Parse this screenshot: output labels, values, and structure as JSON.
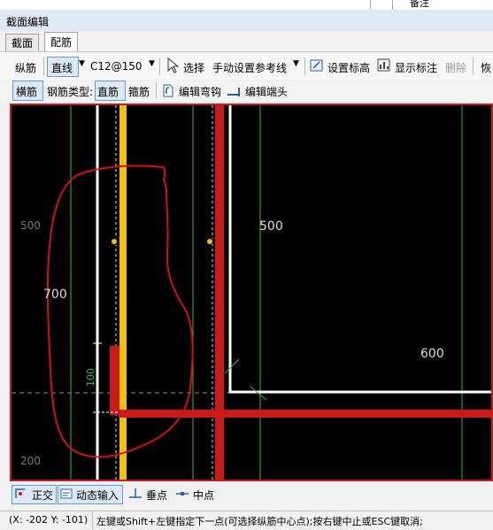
{
  "top_strip": {
    "text": "备注"
  },
  "window": {
    "title": "截面编辑"
  },
  "tabs": [
    {
      "label": "截面"
    },
    {
      "label": "配筋"
    }
  ],
  "toolbar1": {
    "longitudinal": "纵筋",
    "line_mode": "直线",
    "rebar_spec": "C12@150",
    "select": "选择",
    "manual_ref": "手动设置参考线",
    "set_elevation": "设置标高",
    "show_annotation": "显示标注",
    "delete": "删除",
    "restore": "恢"
  },
  "toolbar2": {
    "transverse": "横筋",
    "rebar_type_label": "钢筋类型:",
    "straight": "直筋",
    "stirrup": "箍筋",
    "edit_hook": "编辑弯钩",
    "edit_end": "编辑端头"
  },
  "canvas": {
    "dims": {
      "d500_left": "500",
      "d700": "700",
      "d500": "500",
      "d600": "600",
      "d100": "100",
      "d200": "200"
    }
  },
  "bottom_bar": {
    "ortho": "正交",
    "dynamic_input": "动态输入",
    "perpendicular": "垂点",
    "midpoint": "中点"
  },
  "status": {
    "coords": "(X: -202 Y: -101)",
    "hint": "左键或Shift+左键指定下一点(可选择纵筋中心点);按右键中止或ESC键取消;"
  },
  "colors": {
    "cad_bg": "#000000",
    "rebar_red": "#c81a1a",
    "yellow": "#f2c200",
    "green_grid": "#2fbf2f",
    "white_line": "#ffffff"
  }
}
